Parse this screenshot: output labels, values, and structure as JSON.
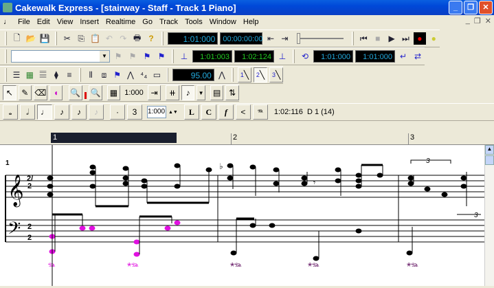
{
  "title": "Cakewalk Express - [stairway - Staff - Track 1 Piano]",
  "menu": [
    "File",
    "Edit",
    "View",
    "Insert",
    "Realtime",
    "Go",
    "Track",
    "Tools",
    "Window",
    "Help"
  ],
  "transport": {
    "now_time": "1:01:000",
    "smpte": "00:00:00:00"
  },
  "markers": {
    "from": "1:01:003",
    "thru": "1:02:124"
  },
  "loop": {
    "start": "1:01:000",
    "end": "1:01:000"
  },
  "tempo": "95.00",
  "tempo_ratios": [
    "1",
    "2",
    "3"
  ],
  "snap_value": "1:000",
  "duration_value": "1:000",
  "note_tools": [
    "L",
    "C",
    "f",
    "<",
    "𝄆"
  ],
  "cursor_info": "1:02:116  D 1 (14)",
  "ruler": [
    "1",
    "2",
    "3"
  ],
  "score": {
    "measure_number": "1",
    "time_sig": "2/2",
    "tuplet": "3"
  }
}
